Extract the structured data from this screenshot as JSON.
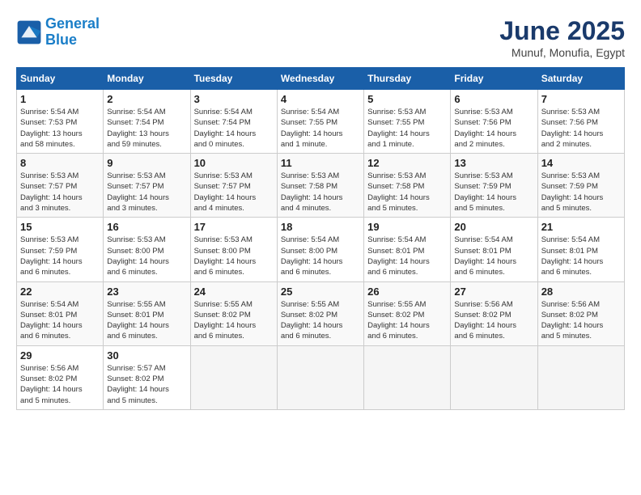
{
  "header": {
    "logo_line1": "General",
    "logo_line2": "Blue",
    "month": "June 2025",
    "location": "Munuf, Monufia, Egypt"
  },
  "days_of_week": [
    "Sunday",
    "Monday",
    "Tuesday",
    "Wednesday",
    "Thursday",
    "Friday",
    "Saturday"
  ],
  "weeks": [
    [
      {
        "day": 1,
        "info": "Sunrise: 5:54 AM\nSunset: 7:53 PM\nDaylight: 13 hours\nand 58 minutes."
      },
      {
        "day": 2,
        "info": "Sunrise: 5:54 AM\nSunset: 7:54 PM\nDaylight: 13 hours\nand 59 minutes."
      },
      {
        "day": 3,
        "info": "Sunrise: 5:54 AM\nSunset: 7:54 PM\nDaylight: 14 hours\nand 0 minutes."
      },
      {
        "day": 4,
        "info": "Sunrise: 5:54 AM\nSunset: 7:55 PM\nDaylight: 14 hours\nand 1 minute."
      },
      {
        "day": 5,
        "info": "Sunrise: 5:53 AM\nSunset: 7:55 PM\nDaylight: 14 hours\nand 1 minute."
      },
      {
        "day": 6,
        "info": "Sunrise: 5:53 AM\nSunset: 7:56 PM\nDaylight: 14 hours\nand 2 minutes."
      },
      {
        "day": 7,
        "info": "Sunrise: 5:53 AM\nSunset: 7:56 PM\nDaylight: 14 hours\nand 2 minutes."
      }
    ],
    [
      {
        "day": 8,
        "info": "Sunrise: 5:53 AM\nSunset: 7:57 PM\nDaylight: 14 hours\nand 3 minutes."
      },
      {
        "day": 9,
        "info": "Sunrise: 5:53 AM\nSunset: 7:57 PM\nDaylight: 14 hours\nand 3 minutes."
      },
      {
        "day": 10,
        "info": "Sunrise: 5:53 AM\nSunset: 7:57 PM\nDaylight: 14 hours\nand 4 minutes."
      },
      {
        "day": 11,
        "info": "Sunrise: 5:53 AM\nSunset: 7:58 PM\nDaylight: 14 hours\nand 4 minutes."
      },
      {
        "day": 12,
        "info": "Sunrise: 5:53 AM\nSunset: 7:58 PM\nDaylight: 14 hours\nand 5 minutes."
      },
      {
        "day": 13,
        "info": "Sunrise: 5:53 AM\nSunset: 7:59 PM\nDaylight: 14 hours\nand 5 minutes."
      },
      {
        "day": 14,
        "info": "Sunrise: 5:53 AM\nSunset: 7:59 PM\nDaylight: 14 hours\nand 5 minutes."
      }
    ],
    [
      {
        "day": 15,
        "info": "Sunrise: 5:53 AM\nSunset: 7:59 PM\nDaylight: 14 hours\nand 6 minutes."
      },
      {
        "day": 16,
        "info": "Sunrise: 5:53 AM\nSunset: 8:00 PM\nDaylight: 14 hours\nand 6 minutes."
      },
      {
        "day": 17,
        "info": "Sunrise: 5:53 AM\nSunset: 8:00 PM\nDaylight: 14 hours\nand 6 minutes."
      },
      {
        "day": 18,
        "info": "Sunrise: 5:54 AM\nSunset: 8:00 PM\nDaylight: 14 hours\nand 6 minutes."
      },
      {
        "day": 19,
        "info": "Sunrise: 5:54 AM\nSunset: 8:01 PM\nDaylight: 14 hours\nand 6 minutes."
      },
      {
        "day": 20,
        "info": "Sunrise: 5:54 AM\nSunset: 8:01 PM\nDaylight: 14 hours\nand 6 minutes."
      },
      {
        "day": 21,
        "info": "Sunrise: 5:54 AM\nSunset: 8:01 PM\nDaylight: 14 hours\nand 6 minutes."
      }
    ],
    [
      {
        "day": 22,
        "info": "Sunrise: 5:54 AM\nSunset: 8:01 PM\nDaylight: 14 hours\nand 6 minutes."
      },
      {
        "day": 23,
        "info": "Sunrise: 5:55 AM\nSunset: 8:01 PM\nDaylight: 14 hours\nand 6 minutes."
      },
      {
        "day": 24,
        "info": "Sunrise: 5:55 AM\nSunset: 8:02 PM\nDaylight: 14 hours\nand 6 minutes."
      },
      {
        "day": 25,
        "info": "Sunrise: 5:55 AM\nSunset: 8:02 PM\nDaylight: 14 hours\nand 6 minutes."
      },
      {
        "day": 26,
        "info": "Sunrise: 5:55 AM\nSunset: 8:02 PM\nDaylight: 14 hours\nand 6 minutes."
      },
      {
        "day": 27,
        "info": "Sunrise: 5:56 AM\nSunset: 8:02 PM\nDaylight: 14 hours\nand 6 minutes."
      },
      {
        "day": 28,
        "info": "Sunrise: 5:56 AM\nSunset: 8:02 PM\nDaylight: 14 hours\nand 5 minutes."
      }
    ],
    [
      {
        "day": 29,
        "info": "Sunrise: 5:56 AM\nSunset: 8:02 PM\nDaylight: 14 hours\nand 5 minutes."
      },
      {
        "day": 30,
        "info": "Sunrise: 5:57 AM\nSunset: 8:02 PM\nDaylight: 14 hours\nand 5 minutes."
      },
      null,
      null,
      null,
      null,
      null
    ]
  ]
}
